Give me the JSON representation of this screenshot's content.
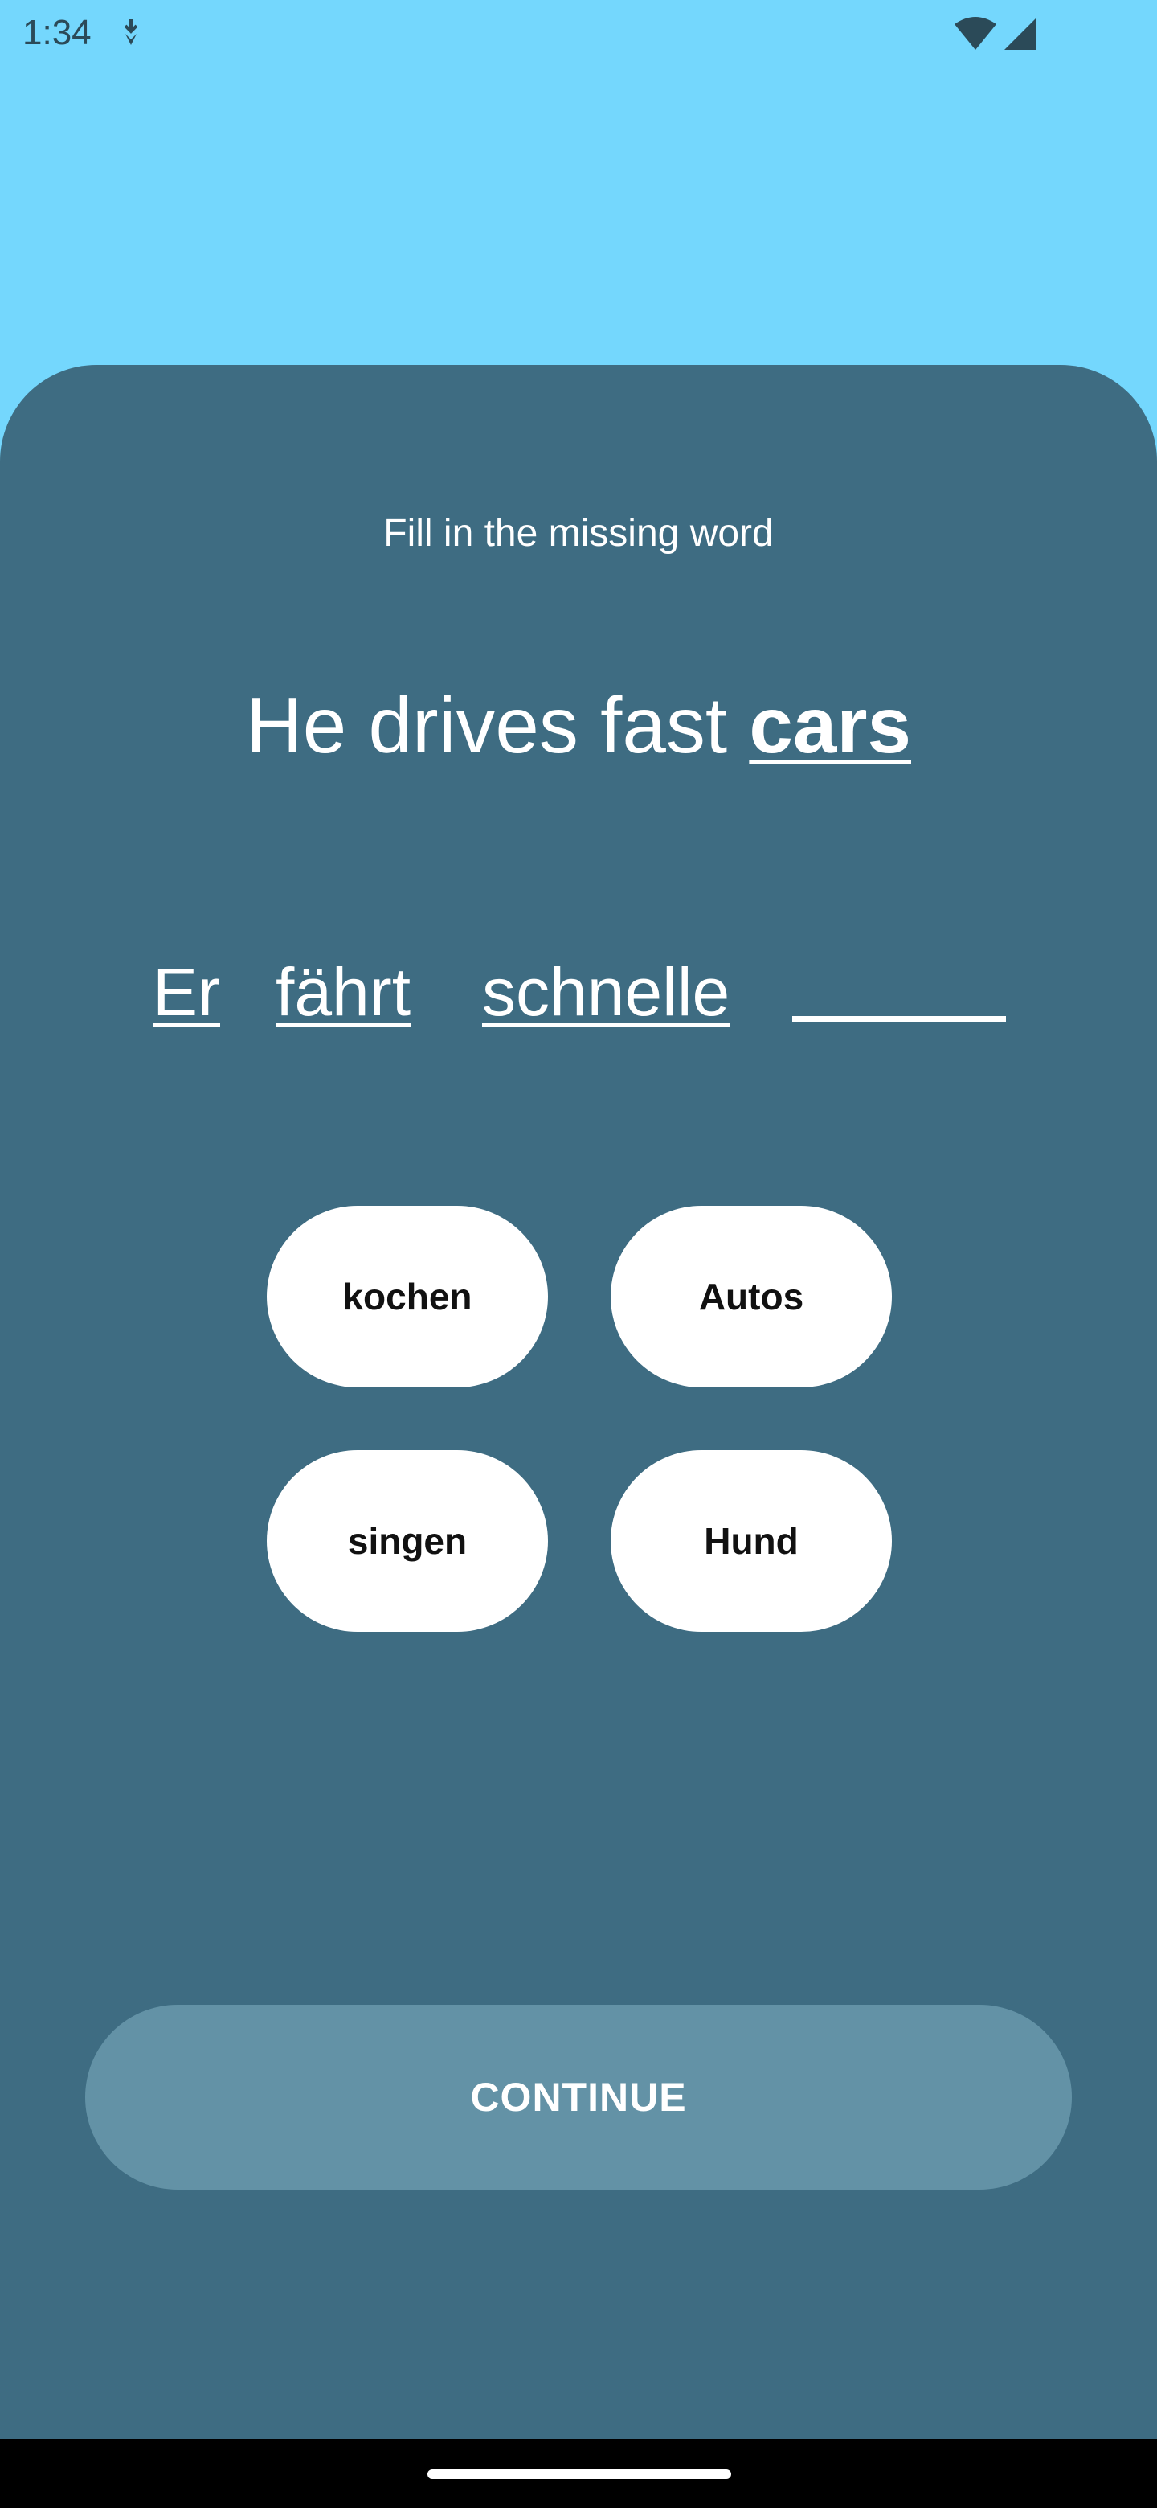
{
  "status_bar": {
    "time": "1:34",
    "icons": [
      "download-icon",
      "wifi-icon",
      "cell-signal-icon"
    ]
  },
  "colors": {
    "sky": "#74D7FD",
    "sheet": "#3E6C82",
    "continue_button": "#6392A6",
    "option_button": "#FFFFFF"
  },
  "exercise": {
    "instruction": "Fill in the missing word",
    "prompt_lead": "He drives fast ",
    "prompt_target": "cars",
    "sentence_words": [
      "Er",
      "fährt",
      "schnelle"
    ],
    "blank": ""
  },
  "options": [
    "kochen",
    "Autos",
    "singen",
    "Hund"
  ],
  "continue_label": "CONTINUE"
}
